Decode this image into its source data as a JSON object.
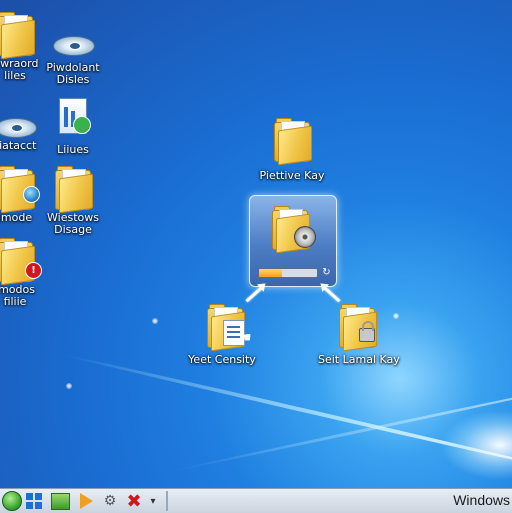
{
  "desktop": {
    "icons": [
      {
        "label": "Fiwraord\nliles",
        "glyph": "folder-icon"
      },
      {
        "label": "Piwdolant\nDisles",
        "glyph": "disc-drive-icon"
      },
      {
        "label": "Fiatacct",
        "glyph": "disc-drive-icon"
      },
      {
        "label": "Liiues",
        "glyph": "document-icon"
      },
      {
        "label": "imode",
        "glyph": "folder-icon"
      },
      {
        "label": "Wiestows\nDisage",
        "glyph": "folder-icon"
      },
      {
        "label": "imodos\nfiliie",
        "glyph": "folder-icon"
      },
      {
        "label": "Piettive Kay",
        "glyph": "folder-icon"
      },
      {
        "label": "Yeet Censity",
        "glyph": "folder-icon"
      },
      {
        "label": "Seit Lamal Kay",
        "glyph": "folder-icon"
      }
    ],
    "window": {
      "glyphs": [
        "folder-icon",
        "cd-icon"
      ],
      "progress": 0.4,
      "refresh_glyph": "↻"
    }
  },
  "taskbar": {
    "right_text": "Windows",
    "close_glyph": "✖",
    "dropdown_glyph": "▾",
    "tools_glyph": "⚙"
  },
  "colors": {
    "desktop_blue": "#1f7fe0",
    "folder_yellow": "#f0c548",
    "error_red": "#d0181c"
  }
}
